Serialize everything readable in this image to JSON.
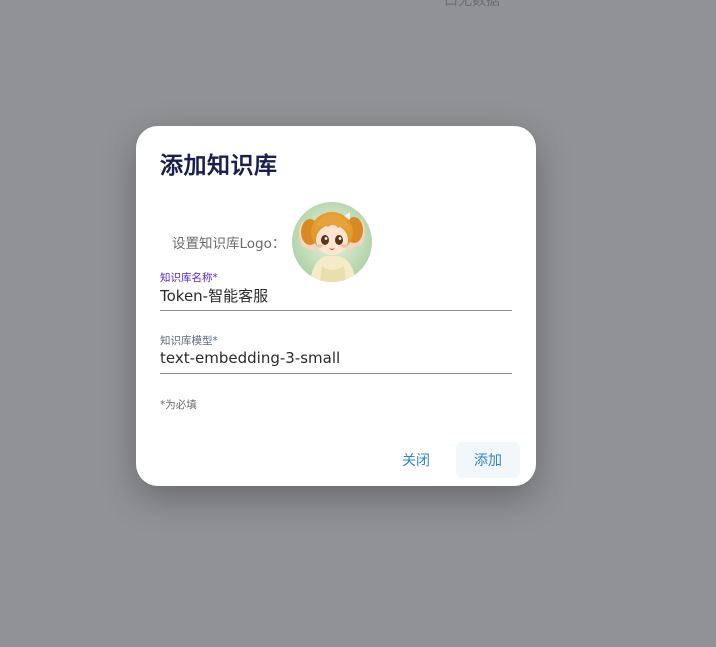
{
  "background": {
    "partial_text": "口无数据"
  },
  "dialog": {
    "title": "添加知识库",
    "logo_label": "设置知识库Logo：",
    "name_field": {
      "label": "知识库名称*",
      "value": "Token-智能客服"
    },
    "model_field": {
      "label": "知识库模型*",
      "value": "text-embedding-3-small"
    },
    "required_note": "*为必填",
    "buttons": {
      "close": "关闭",
      "add": "添加"
    }
  },
  "colors": {
    "accent": "#2e86c9",
    "focus_label": "#5a24e0",
    "title": "#1b1f4d",
    "overlay": "#919296"
  }
}
